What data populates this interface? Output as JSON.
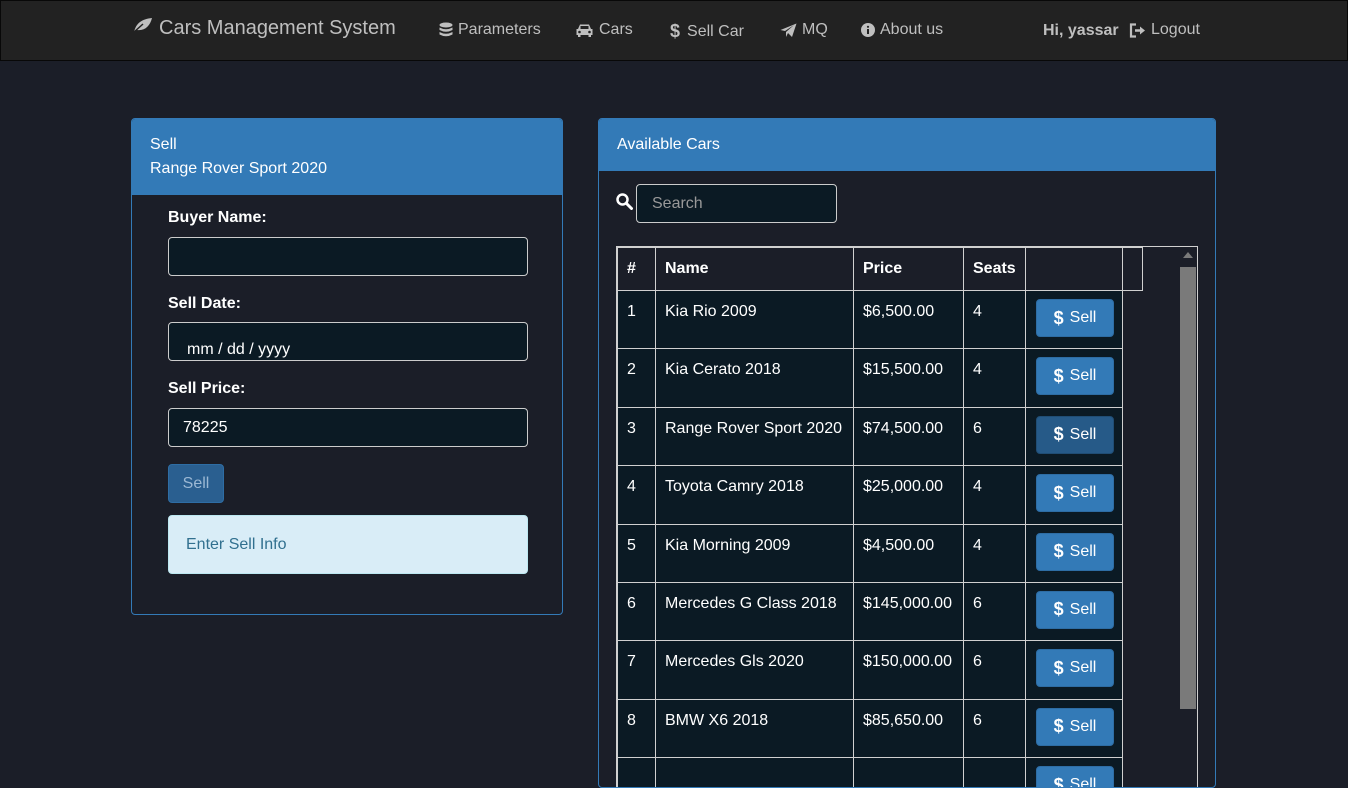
{
  "navbar": {
    "brand": "Cars Management System",
    "items": [
      {
        "label": "Parameters",
        "icon": "database-icon"
      },
      {
        "label": "Cars",
        "icon": "car-icon"
      },
      {
        "label": "Sell Car",
        "icon": "dollar-icon"
      },
      {
        "label": "MQ",
        "icon": "paper-plane-icon"
      },
      {
        "label": "About us",
        "icon": "info-icon"
      }
    ],
    "greeting": "Hi, yassar",
    "logout": "Logout"
  },
  "sell_panel": {
    "heading_line1": "Sell",
    "heading_line2": "Range Rover Sport 2020",
    "buyer_label": "Buyer Name:",
    "buyer_value": "",
    "date_label": "Sell Date:",
    "date_placeholder": "mm / dd / yyyy",
    "price_label": "Sell Price:",
    "price_value": "78225",
    "submit_label": "Sell",
    "info_text": "Enter Sell Info"
  },
  "cars_panel": {
    "heading": "Available Cars",
    "search_placeholder": "Search",
    "columns": [
      "#",
      "Name",
      "Price",
      "Seats"
    ],
    "sell_label": "Sell",
    "rows": [
      {
        "num": "1",
        "name": "Kia Rio 2009",
        "price": "$6,500.00",
        "seats": "4"
      },
      {
        "num": "2",
        "name": "Kia Cerato 2018",
        "price": "$15,500.00",
        "seats": "4"
      },
      {
        "num": "3",
        "name": "Range Rover Sport 2020",
        "price": "$74,500.00",
        "seats": "6"
      },
      {
        "num": "4",
        "name": "Toyota Camry 2018",
        "price": "$25,000.00",
        "seats": "4"
      },
      {
        "num": "5",
        "name": "Kia Morning 2009",
        "price": "$4,500.00",
        "seats": "4"
      },
      {
        "num": "6",
        "name": "Mercedes G Class 2018",
        "price": "$145,000.00",
        "seats": "6"
      },
      {
        "num": "7",
        "name": "Mercedes Gls 2020",
        "price": "$150,000.00",
        "seats": "6"
      },
      {
        "num": "8",
        "name": "BMW X6 2018",
        "price": "$85,650.00",
        "seats": "6"
      },
      {
        "num": "",
        "name": "",
        "price": "",
        "seats": ""
      }
    ]
  }
}
